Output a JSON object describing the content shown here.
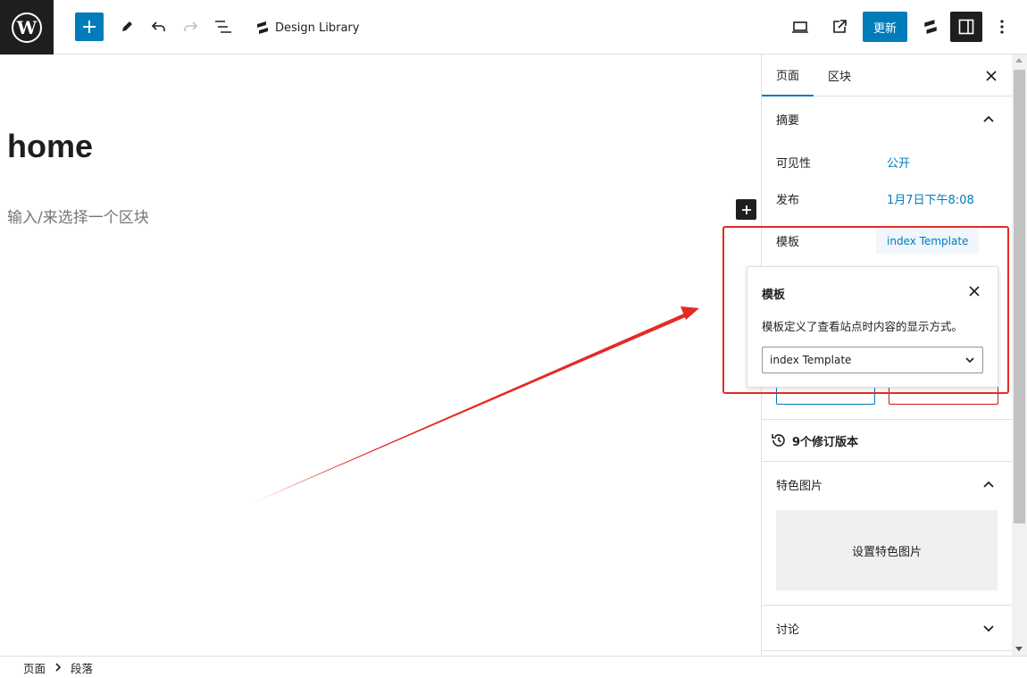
{
  "toolbar": {
    "design_library_label": "Design Library",
    "update_label": "更新"
  },
  "editor": {
    "post_title": "home",
    "block_placeholder": "输入/来选择一个区块"
  },
  "sidebar": {
    "tabs": [
      {
        "label": "页面",
        "active": true
      },
      {
        "label": "区块",
        "active": false
      }
    ],
    "summary": {
      "title": "摘要",
      "visibility_label": "可见性",
      "visibility_value": "公开",
      "publish_label": "发布",
      "publish_value": "1月7日下午8:08",
      "template_label": "模板",
      "template_value": "index Template"
    },
    "revisions_label": "9个修订版本",
    "featured_image": {
      "title": "特色图片",
      "button_label": "设置特色图片"
    },
    "discussion_title": "讨论"
  },
  "popover": {
    "title": "模板",
    "description": "模板定义了查看站点时内容的显示方式。",
    "selected_template": "index Template"
  },
  "breadcrumb": {
    "items": [
      "页面",
      "段落"
    ]
  },
  "colors": {
    "accent": "#007cba",
    "annotation_red": "#e32b25",
    "dark": "#1e1e1e"
  }
}
